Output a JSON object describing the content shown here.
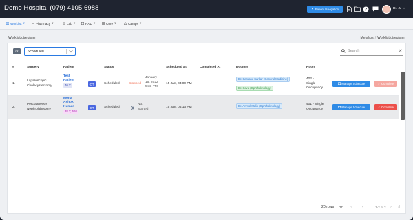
{
  "app": {
    "title": "Demo Hospital (079) 4105 6988"
  },
  "header": {
    "patient_nav_label": "Patient Navigation",
    "user_name": "Dr. JJ"
  },
  "menu": [
    {
      "label": "Worklist",
      "active": true,
      "icon": "list-icon"
    },
    {
      "label": "Pharmacy",
      "active": false,
      "icon": "pill-icon"
    },
    {
      "label": "Lab",
      "active": false,
      "icon": "lab-icon"
    },
    {
      "label": "RAD",
      "active": false,
      "icon": "radiology-icon"
    },
    {
      "label": "Core",
      "active": false,
      "icon": "core-icon"
    },
    {
      "label": "Camps",
      "active": false,
      "icon": "camps-icon"
    }
  ],
  "breadcrumb": {
    "left": "Worklist/otregister",
    "right_home": "Metahos",
    "right_page": "Worklist/otregister"
  },
  "filters": {
    "status_value": "Scheduled",
    "search_placeholder": "Search"
  },
  "table": {
    "columns": [
      "#",
      "Surgery",
      "Patient",
      "Status",
      "Scheduled At",
      "Completed At",
      "Doctors",
      "Room"
    ],
    "rows": [
      {
        "num": "1.",
        "surgery_l1": "Laparoscopic",
        "surgery_l2": "Cholecystectomy",
        "patient_l1": "Test",
        "patient_l2": "Patient",
        "age": "40 Y",
        "ot": "OT",
        "status": "Scheduled",
        "sub_status": "Stopped",
        "sub_date_l1": "January",
        "sub_date_l2": "15, 2022",
        "sub_date_l3": "5:33 PM",
        "scheduled_at": "15 Jan, 04:00 PM",
        "completed_at": "",
        "doctors": [
          "Dr. Santanu Sarkar (General Medicine)",
          "Dr. Sova (Ophthalmology)"
        ],
        "room_l1": "402 -",
        "room_l2": "Single",
        "room_l3": "Occupancy",
        "manage_label": "Manage Schedule",
        "complete_label": "Complete"
      },
      {
        "num": "2.",
        "surgery_l1": "Percutaneous",
        "surgery_l2": "Nephrolithotomy",
        "patient_l1": "Mona",
        "patient_l2": "Ashok",
        "patient_l3": "Kumar",
        "age": "38 Y, 5 M",
        "ot": "OT",
        "status": "Scheduled",
        "sub_status_l1": "Not",
        "sub_status_l2": "Started",
        "scheduled_at": "15 Jan, 06:13 PM",
        "completed_at": "",
        "doctors": [
          "Dr. Anmol Malik (Ophthalmology)"
        ],
        "room_l1": "401 - Single",
        "room_l2": "Occupancy",
        "manage_label": "Manage Schedule",
        "complete_label": "Complete"
      }
    ]
  },
  "pagination": {
    "rows_per_page": "20 rows",
    "range_text": "1-2 of 2"
  },
  "colors": {
    "header_bg": "#1f2430",
    "accent_blue": "#2f8be6",
    "danger_red": "#ec4f4a",
    "ot_badge": "#4a67e0"
  }
}
